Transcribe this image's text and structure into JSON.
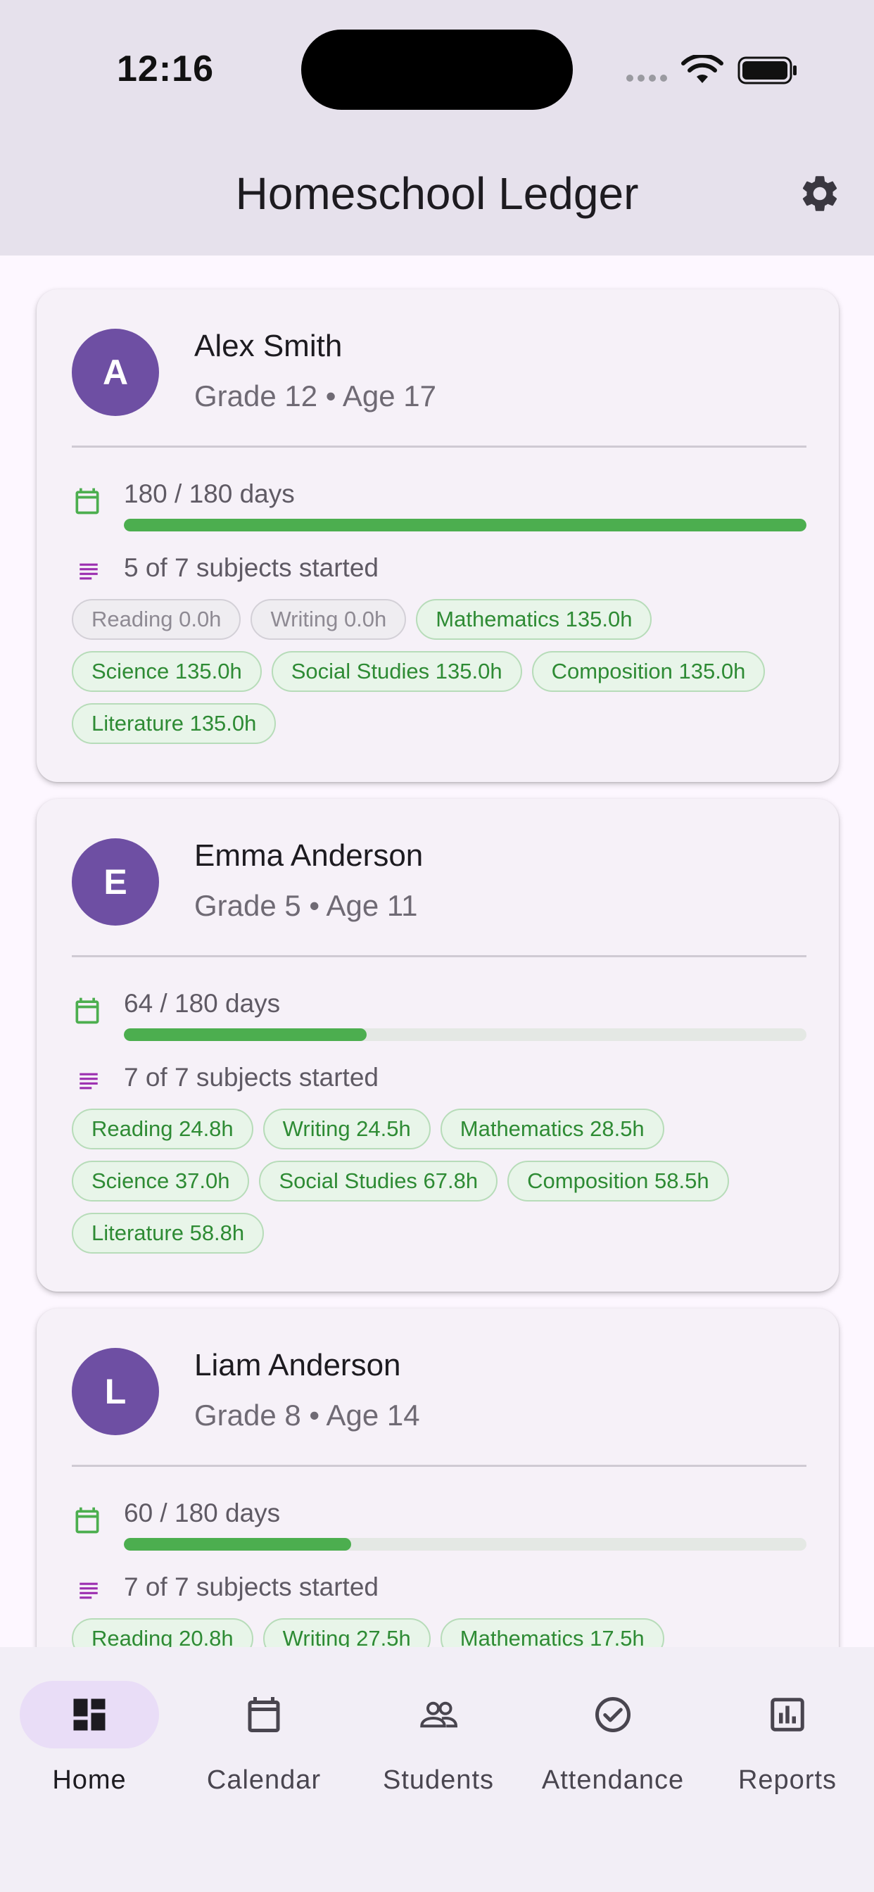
{
  "status_bar": {
    "time": "12:16"
  },
  "app_bar": {
    "title": "Homeschool Ledger"
  },
  "students": [
    {
      "initial": "A",
      "name": "Alex Smith",
      "meta": "Grade 12 • Age 17",
      "days_label": "180 / 180 days",
      "days_done": 180,
      "days_total": 180,
      "subjects_label": "5 of 7 subjects started",
      "chips": [
        {
          "label": "Reading 0.0h",
          "active": false
        },
        {
          "label": "Writing 0.0h",
          "active": false
        },
        {
          "label": "Mathematics 135.0h",
          "active": true
        },
        {
          "label": "Science 135.0h",
          "active": true
        },
        {
          "label": "Social Studies 135.0h",
          "active": true
        },
        {
          "label": "Composition 135.0h",
          "active": true
        },
        {
          "label": "Literature 135.0h",
          "active": true
        }
      ]
    },
    {
      "initial": "E",
      "name": "Emma Anderson",
      "meta": "Grade 5 • Age 11",
      "days_label": "64 / 180 days",
      "days_done": 64,
      "days_total": 180,
      "subjects_label": "7 of 7 subjects started",
      "chips": [
        {
          "label": "Reading 24.8h",
          "active": true
        },
        {
          "label": "Writing 24.5h",
          "active": true
        },
        {
          "label": "Mathematics 28.5h",
          "active": true
        },
        {
          "label": "Science 37.0h",
          "active": true
        },
        {
          "label": "Social Studies 67.8h",
          "active": true
        },
        {
          "label": "Composition 58.5h",
          "active": true
        },
        {
          "label": "Literature 58.8h",
          "active": true
        }
      ]
    },
    {
      "initial": "L",
      "name": "Liam Anderson",
      "meta": "Grade 8 • Age 14",
      "days_label": "60 / 180 days",
      "days_done": 60,
      "days_total": 180,
      "subjects_label": "7 of 7 subjects started",
      "chips": [
        {
          "label": "Reading 20.8h",
          "active": true
        },
        {
          "label": "Writing 27.5h",
          "active": true
        },
        {
          "label": "Mathematics 17.5h",
          "active": true
        }
      ]
    }
  ],
  "bottom_nav": [
    {
      "label": "Home",
      "icon": "dashboard-icon",
      "selected": true
    },
    {
      "label": "Calendar",
      "icon": "calendar-icon",
      "selected": false
    },
    {
      "label": "Students",
      "icon": "people-icon",
      "selected": false
    },
    {
      "label": "Attendance",
      "icon": "check-circle-icon",
      "selected": false
    },
    {
      "label": "Reports",
      "icon": "bar-chart-icon",
      "selected": false
    }
  ],
  "colors": {
    "avatar": "#6e4fa3",
    "progress": "#4cae4f",
    "chip_active_text": "#2e8b34",
    "subjects_icon": "#9c2fb0",
    "calendar_icon": "#4cae4f"
  }
}
